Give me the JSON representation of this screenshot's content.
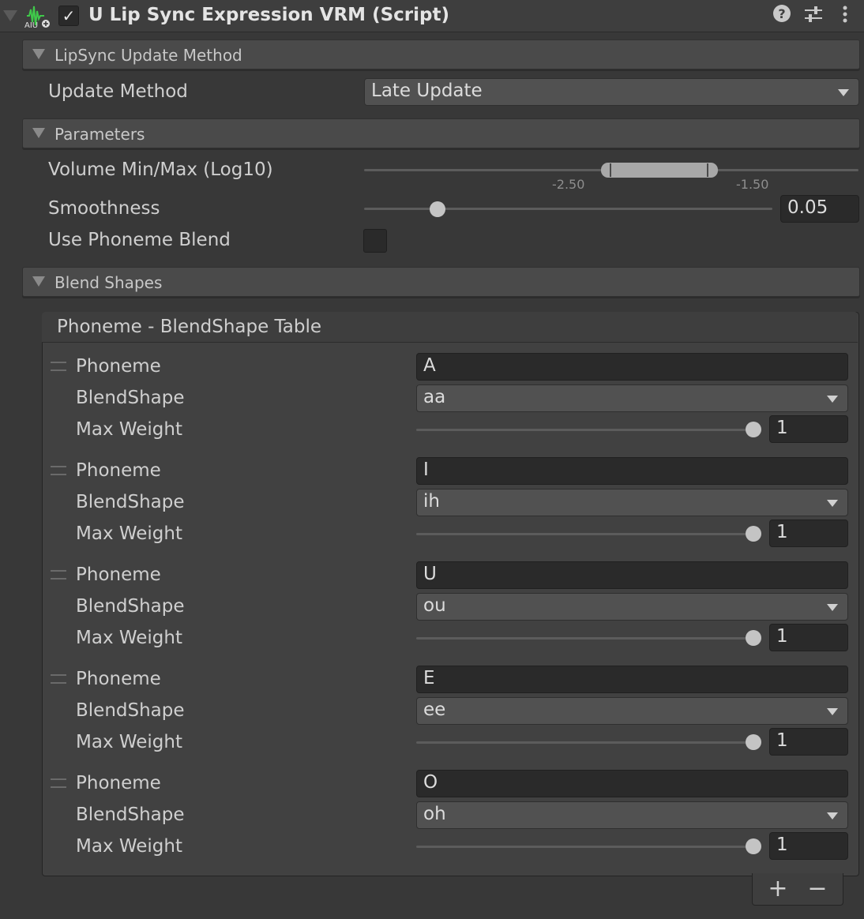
{
  "component": {
    "title": "U Lip Sync Expression VRM (Script)",
    "enabled": true,
    "icons": [
      "help-icon",
      "presets-icon",
      "more-icon"
    ]
  },
  "sections": {
    "update": {
      "label": "LipSync Update Method"
    },
    "params": {
      "label": "Parameters"
    },
    "blend": {
      "label": "Blend Shapes"
    }
  },
  "update_method": {
    "label": "Update Method",
    "value": "Late Update"
  },
  "volume": {
    "label": "Volume Min/Max (Log10)",
    "tick_left": "-2.50",
    "tick_right": "-1.50"
  },
  "smoothness": {
    "label": "Smoothness",
    "value": "0.05",
    "fraction": 0.18
  },
  "use_phoneme_blend": {
    "label": "Use Phoneme Blend",
    "checked": false
  },
  "table": {
    "title": "Phoneme - BlendShape Table",
    "rows": [
      {
        "phoneme_label": "Phoneme",
        "phoneme": "A",
        "blendshape_label": "BlendShape",
        "blendshape": "aa",
        "weight_label": "Max Weight",
        "weight": "1"
      },
      {
        "phoneme_label": "Phoneme",
        "phoneme": "I",
        "blendshape_label": "BlendShape",
        "blendshape": "ih",
        "weight_label": "Max Weight",
        "weight": "1"
      },
      {
        "phoneme_label": "Phoneme",
        "phoneme": "U",
        "blendshape_label": "BlendShape",
        "blendshape": "ou",
        "weight_label": "Max Weight",
        "weight": "1"
      },
      {
        "phoneme_label": "Phoneme",
        "phoneme": "E",
        "blendshape_label": "BlendShape",
        "blendshape": "ee",
        "weight_label": "Max Weight",
        "weight": "1"
      },
      {
        "phoneme_label": "Phoneme",
        "phoneme": "O",
        "blendshape_label": "BlendShape",
        "blendshape": "oh",
        "weight_label": "Max Weight",
        "weight": "1"
      }
    ],
    "add_label": "+",
    "remove_label": "−"
  }
}
